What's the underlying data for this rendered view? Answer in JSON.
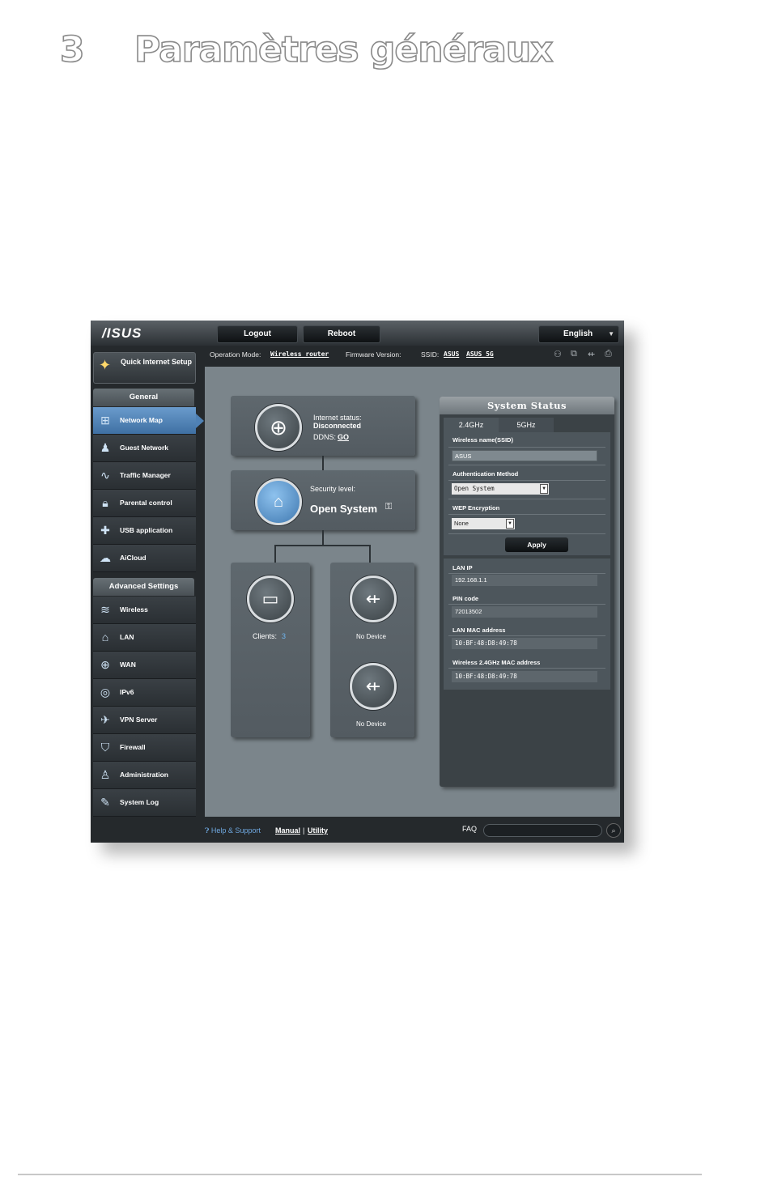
{
  "page": {
    "chapter_number": "3",
    "chapter_title": "Paramètres généraux"
  },
  "router": {
    "logo": "/ISUS",
    "topbar": {
      "logout": "Logout",
      "reboot": "Reboot",
      "language": "English"
    },
    "info": {
      "operation_mode_label": "Operation Mode:",
      "operation_mode_value": "Wireless router",
      "firmware_label": "Firmware Version:",
      "ssid_label": "SSID:",
      "ssid_1": "ASUS",
      "ssid_2": "ASUS_5G"
    },
    "sidebar": {
      "quick_setup": "Quick Internet Setup",
      "general_header": "General",
      "general_items": [
        {
          "label": "Network Map",
          "icon": "network-map-icon"
        },
        {
          "label": "Guest Network",
          "icon": "guest-network-icon"
        },
        {
          "label": "Traffic Manager",
          "icon": "traffic-manager-icon"
        },
        {
          "label": "Parental control",
          "icon": "lock-icon"
        },
        {
          "label": "USB application",
          "icon": "puzzle-icon"
        },
        {
          "label": "AiCloud",
          "icon": "cloud-home-icon"
        }
      ],
      "advanced_header": "Advanced Settings",
      "advanced_items": [
        {
          "label": "Wireless",
          "icon": "wifi-icon"
        },
        {
          "label": "LAN",
          "icon": "home-icon"
        },
        {
          "label": "WAN",
          "icon": "globe-icon"
        },
        {
          "label": "IPv6",
          "icon": "ipv6-icon"
        },
        {
          "label": "VPN Server",
          "icon": "vpn-icon"
        },
        {
          "label": "Firewall",
          "icon": "shield-icon"
        },
        {
          "label": "Administration",
          "icon": "admin-icon"
        },
        {
          "label": "System Log",
          "icon": "system-log-icon"
        }
      ]
    },
    "map": {
      "internet_status_label": "Internet status:",
      "internet_status_value": "Disconnected",
      "ddns_label": "DDNS:",
      "ddns_value": "GO",
      "security_label": "Security level:",
      "security_value": "Open System",
      "clients_label": "Clients:",
      "clients_count": "3",
      "usb1": "No Device",
      "usb2": "No Device"
    },
    "system_status": {
      "title": "System Status",
      "tab_24": "2.4GHz",
      "tab_5": "5GHz",
      "ssid_label": "Wireless name(SSID)",
      "ssid_value": "ASUS",
      "auth_label": "Authentication Method",
      "auth_value": "Open System",
      "wep_label": "WEP Encryption",
      "wep_value": "None",
      "apply": "Apply",
      "lan_ip_label": "LAN IP",
      "lan_ip_value": "192.168.1.1",
      "pin_label": "PIN code",
      "pin_value": "72013502",
      "lan_mac_label": "LAN MAC address",
      "lan_mac_value": "10:BF:48:D8:49:78",
      "wl_mac_label": "Wireless 2.4GHz MAC address",
      "wl_mac_value": "10:BF:48:D8:49:78"
    },
    "footer": {
      "help": "Help & Support",
      "manual": "Manual",
      "separator": "|",
      "utility": "Utility",
      "faq": "FAQ"
    },
    "colors": {
      "accent_blue": "#4f81b5",
      "panel": "#7b858b",
      "dark": "#25292c"
    }
  }
}
